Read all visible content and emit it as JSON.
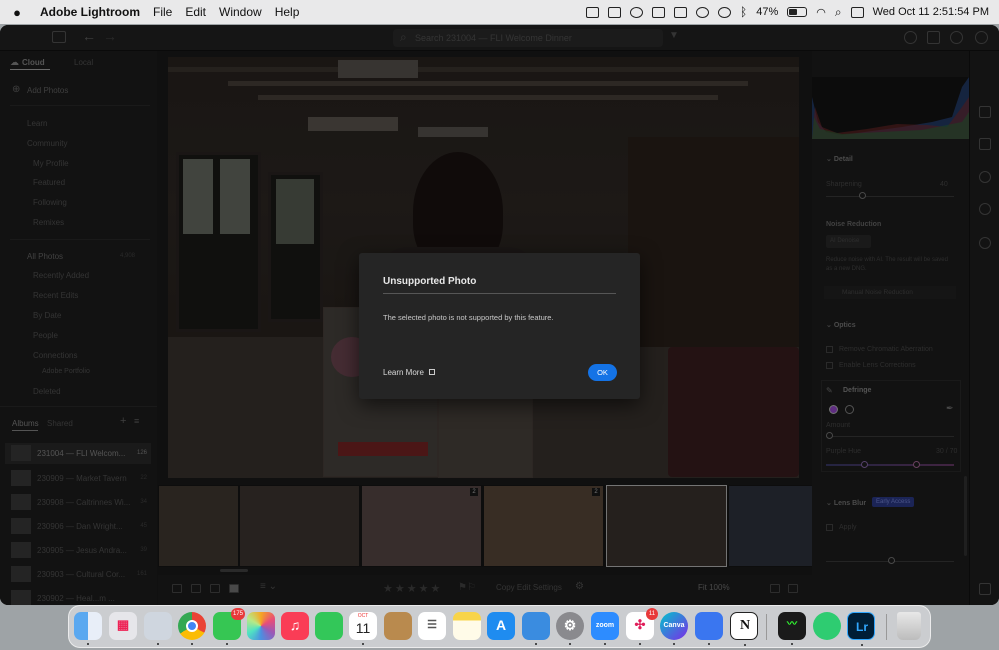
{
  "menubar": {
    "app_name": "Adobe Lightroom",
    "menus": [
      "File",
      "Edit",
      "Window",
      "Help"
    ],
    "battery": "47%",
    "datetime": "Wed Oct 11  2:51:54 PM"
  },
  "titlebar": {
    "search_placeholder": "Search 231004 — FLI Welcome Dinner"
  },
  "left_panel": {
    "tabs": [
      "Cloud",
      "Local"
    ],
    "add_photos": "Add Photos",
    "learn": "Learn",
    "community": "Community",
    "community_items": [
      "My Profile",
      "Featured",
      "Following",
      "Remixes"
    ],
    "all_photos": "All Photos",
    "all_photos_count": "4,908",
    "library_items": [
      "Recently Added",
      "Recent Edits",
      "By Date",
      "People",
      "Connections"
    ],
    "adobe_portfolio": "Adobe Portfolio",
    "deleted": "Deleted",
    "album_tabs": [
      "Albums",
      "Shared"
    ],
    "albums": [
      {
        "name": "231004 — FLI Welcom...",
        "count": "126"
      },
      {
        "name": "230909 — Market Tavern",
        "count": "22"
      },
      {
        "name": "230908 — Caltrinnes Wi...",
        "count": "34"
      },
      {
        "name": "230906 — Dan Wright...",
        "count": "45"
      },
      {
        "name": "230905 — Jesus Andra...",
        "count": "39"
      },
      {
        "name": "230903 — Cultural Cor...",
        "count": "161"
      },
      {
        "name": "230902 — Heal...m ...",
        "count": ""
      }
    ]
  },
  "filmstrip": {
    "badges": [
      "2",
      "2"
    ]
  },
  "bottom_bar": {
    "stars": "★★★★★",
    "copy_edit": "Copy Edit Settings",
    "fit": "Fit  100%"
  },
  "right_panel": {
    "detail": "Detail",
    "sharpening": "Sharpening",
    "sharpening_value": "40",
    "noise_reduction": "Noise Reduction",
    "denoise": "AI Denoise",
    "denoise_desc_1": "Reduce noise with AI. The result will be saved",
    "denoise_desc_2": "as a new DNG.",
    "manual_noise": "Manual Noise Reduction",
    "optics": "Optics",
    "remove_ca": "Remove Chromatic Aberration",
    "lens_corr": "Enable Lens Corrections",
    "defringe": "Defringe",
    "purple_amount": "Amount",
    "purple_hue": "Purple Hue",
    "purple_hue_value": "30 / 70",
    "lens_blur": "Lens Blur",
    "early_access": "Early Access",
    "apply": "Apply"
  },
  "dialog": {
    "title": "Unsupported Photo",
    "message": "The selected photo is not supported by this feature.",
    "learn_more": "Learn More",
    "ok": "OK"
  },
  "dock": {
    "calendar_month": "OCT",
    "calendar_day": "11",
    "messages_badge": "175",
    "slack_badge": "11",
    "zoom_label": "zoom",
    "canva_label": "Canva",
    "lr_label": "Lr",
    "notion_label": "N"
  },
  "colors": {
    "accent_blue": "#1473e6",
    "dialog_bg": "#252525",
    "early_access_bg": "#2c3a8c"
  }
}
